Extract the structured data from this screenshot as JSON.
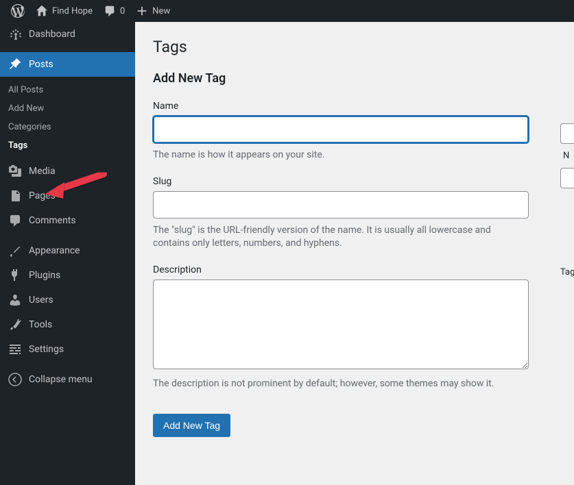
{
  "topbar": {
    "site_name": "Find Hope",
    "comments_count": "0",
    "new_label": "New"
  },
  "sidebar": {
    "dashboard": "Dashboard",
    "posts": "Posts",
    "submenu": {
      "all_posts": "All Posts",
      "add_new": "Add New",
      "categories": "Categories",
      "tags": "Tags"
    },
    "media": "Media",
    "pages": "Pages",
    "comments": "Comments",
    "appearance": "Appearance",
    "plugins": "Plugins",
    "users": "Users",
    "tools": "Tools",
    "settings": "Settings",
    "collapse": "Collapse menu"
  },
  "main": {
    "title": "Tags",
    "form_title": "Add New Tag",
    "name_label": "Name",
    "name_desc": "The name is how it appears on your site.",
    "slug_label": "Slug",
    "slug_desc": "The \"slug\" is the URL-friendly version of the name. It is usually all lowercase and contains only letters, numbers, and hyphens.",
    "desc_label": "Description",
    "desc_desc": "The description is not prominent by default; however, some themes may show it.",
    "submit": "Add New Tag"
  },
  "right_peek": {
    "n": "N",
    "tag": "Tag"
  }
}
